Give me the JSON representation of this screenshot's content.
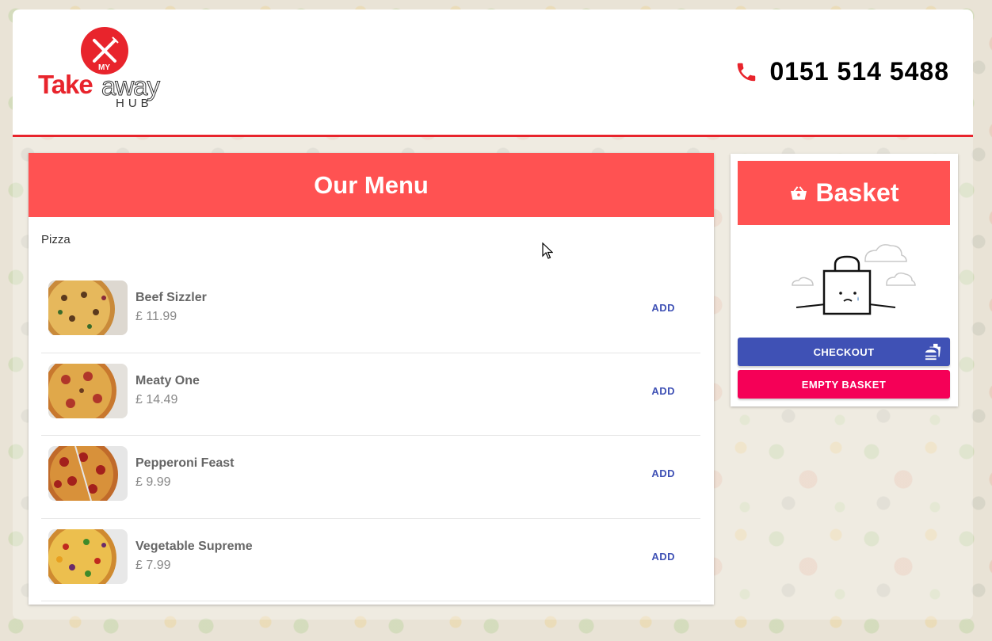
{
  "header": {
    "logo": {
      "my": "MY",
      "take": "Take",
      "away": "away",
      "hub": "HUB"
    },
    "phone_icon": "phone-icon",
    "phone_number": "0151 514 5488"
  },
  "menu": {
    "title": "Our Menu",
    "category": "Pizza",
    "items": [
      {
        "name": "Beef Sizzler",
        "price": "£ 11.99",
        "add_label": "ADD"
      },
      {
        "name": "Meaty One",
        "price": "£ 14.49",
        "add_label": "ADD"
      },
      {
        "name": "Pepperoni Feast",
        "price": "£ 9.99",
        "add_label": "ADD"
      },
      {
        "name": "Vegetable Supreme",
        "price": "£ 7.99",
        "add_label": "ADD"
      }
    ]
  },
  "basket": {
    "icon": "basket-icon",
    "title": "Basket",
    "checkout_label": "CHECKOUT",
    "empty_label": "EMPTY BASKET"
  },
  "colors": {
    "accent_red": "#ff5252",
    "brand_red": "#e8242c",
    "checkout_blue": "#3f51b5",
    "empty_pink": "#f50057"
  }
}
